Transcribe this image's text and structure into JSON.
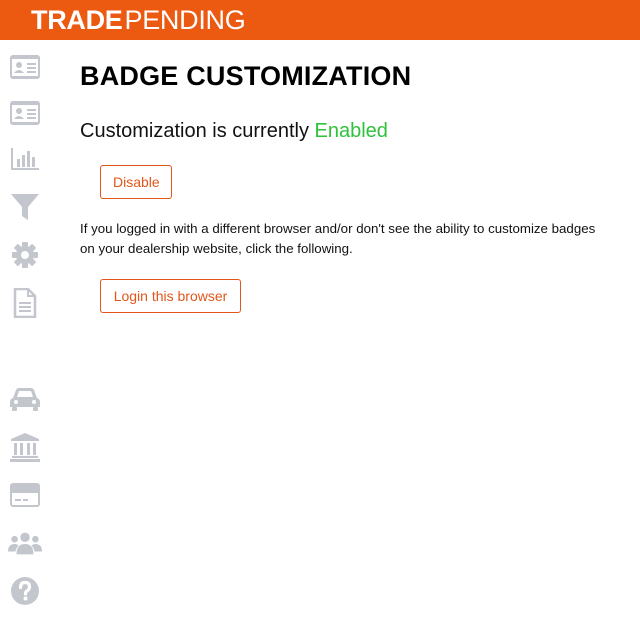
{
  "brand": {
    "name_bold": "TRADE",
    "name_light": "PENDING",
    "color": "#ec5a12"
  },
  "sidebar": {
    "icon_color": "#c3c6cc",
    "items": [
      {
        "icon": "id-card-icon"
      },
      {
        "icon": "id-card-icon"
      },
      {
        "icon": "bar-chart-icon"
      },
      {
        "icon": "filter-icon"
      },
      {
        "icon": "gear-icon"
      },
      {
        "icon": "document-icon"
      },
      {
        "icon": "car-icon"
      },
      {
        "icon": "bank-icon"
      },
      {
        "icon": "credit-card-icon"
      },
      {
        "icon": "users-icon"
      },
      {
        "icon": "help-icon"
      }
    ]
  },
  "main": {
    "title": "BADGE CUSTOMIZATION",
    "status_prefix": "Customization is currently ",
    "status_value": "Enabled",
    "status_color": "#2ec13b",
    "disable_label": "Disable",
    "help_text": "If you logged in with a different browser and/or don't see the ability to customize badges on your dealership website, click the following.",
    "login_label": "Login this browser"
  }
}
